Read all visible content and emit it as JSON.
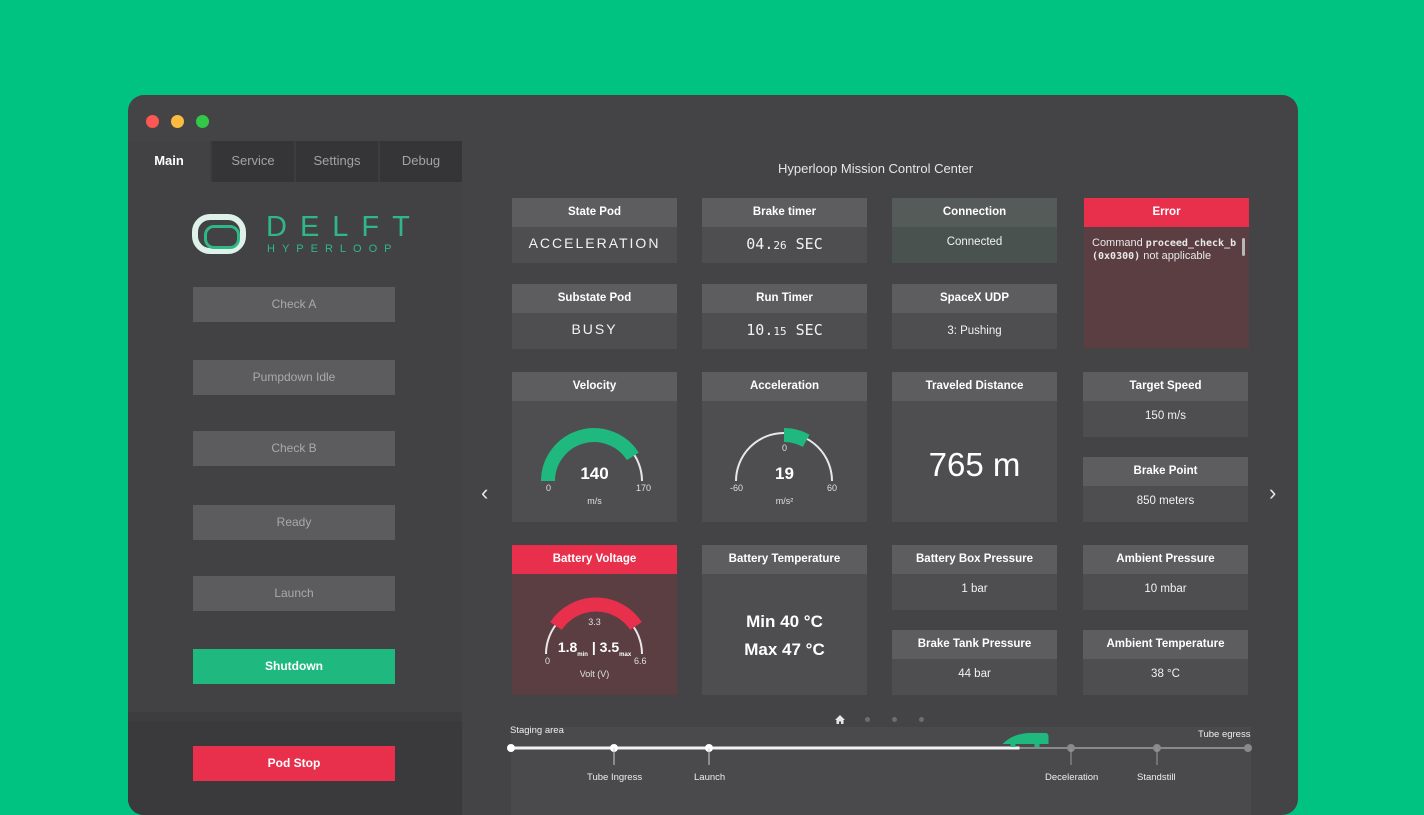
{
  "sidebar": {
    "tabs": [
      {
        "label": "Main",
        "active": true
      },
      {
        "label": "Service"
      },
      {
        "label": "Settings"
      },
      {
        "label": "Debug"
      }
    ],
    "logo_text": "DELFT",
    "logo_sub": "HYPERLOOP",
    "buttons": [
      {
        "label": "Check A"
      },
      {
        "label": "Pumpdown Idle"
      },
      {
        "label": "Check B"
      },
      {
        "label": "Ready"
      },
      {
        "label": "Launch"
      },
      {
        "label": "Shutdown"
      }
    ],
    "pod_stop": "Pod Stop"
  },
  "main": {
    "title": "Hyperloop Mission Control Center",
    "state_pod": {
      "label": "State Pod",
      "value": "ACCELERATION"
    },
    "brake_timer": {
      "label": "Brake timer",
      "int": "04.",
      "frac": "26",
      "unit": " SEC"
    },
    "connection": {
      "label": "Connection",
      "value": "Connected"
    },
    "error": {
      "label": "Error",
      "pre": "Command ",
      "code": "proceed_check_b (0x0300)",
      "post": " not applicable"
    },
    "substate_pod": {
      "label": "Substate Pod",
      "value": "BUSY"
    },
    "run_timer": {
      "label": "Run Timer",
      "int": "10.",
      "frac": "15",
      "unit": " SEC"
    },
    "spacex_udp": {
      "label": "SpaceX UDP",
      "value": "3: Pushing"
    },
    "velocity": {
      "label": "Velocity",
      "value": "140",
      "min": "0",
      "max": "170",
      "unit": "m/s",
      "level": 0.82
    },
    "acceleration": {
      "label": "Acceleration",
      "value": "19",
      "min": "-60",
      "max": "60",
      "zero": "0",
      "unit": "m/s²",
      "level": 0.16
    },
    "distance": {
      "label": "Traveled Distance",
      "value": "765",
      "unit": "m"
    },
    "target_speed": {
      "label": "Target Speed",
      "value": "150 m/s"
    },
    "brake_point": {
      "label": "Brake Point",
      "value": "850 meters"
    },
    "battery_voltage": {
      "label": "Battery Voltage",
      "min_v": "1.8",
      "max_v": "3.5",
      "min_sub": "min",
      "max_sub": "max",
      "mid": "3.3",
      "low": "0",
      "high": "6.6",
      "unit": "Volt (V)"
    },
    "battery_temp": {
      "label": "Battery Temperature",
      "min": "Min 40 °C",
      "max": "Max 47 °C"
    },
    "battery_box_pressure": {
      "label": "Battery Box Pressure",
      "value": "1 bar"
    },
    "ambient_pressure": {
      "label": "Ambient Pressure",
      "value": "10 mbar"
    },
    "brake_tank_pressure": {
      "label": "Brake Tank Pressure",
      "value": "44 bar"
    },
    "ambient_temp": {
      "label": "Ambient Temperature",
      "value": "38 °C"
    }
  },
  "track": {
    "start": "Staging area",
    "end": "Tube egress",
    "stops": [
      "Tube Ingress",
      "Launch",
      "Deceleration",
      "Standstill"
    ],
    "progress": 0.69
  },
  "colors": {
    "background": "#00c281",
    "accent": "#1fb980",
    "alert": "#e8304d",
    "window": "#444446"
  }
}
